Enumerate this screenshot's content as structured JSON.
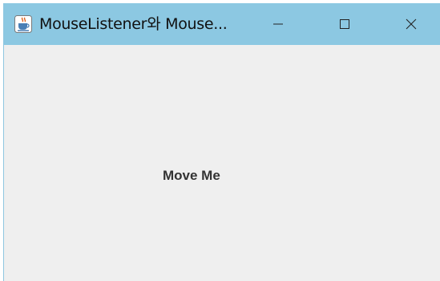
{
  "window": {
    "title": "MouseListener와 Mouse...",
    "app_icon": "java-coffee-icon",
    "controls": {
      "minimize_icon": "minimize-icon",
      "maximize_icon": "maximize-icon",
      "close_icon": "close-icon"
    }
  },
  "content": {
    "label_text": "Move Me"
  },
  "colors": {
    "titlebar": "#8cc8e2",
    "content_bg": "#efefef",
    "label": "#333333"
  }
}
